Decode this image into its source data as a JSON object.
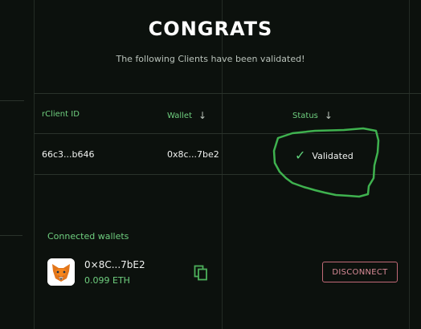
{
  "header": {
    "title": "CONGRATS",
    "subtitle": "The following Clients have been validated!"
  },
  "table": {
    "columns": [
      {
        "label": "rClient ID",
        "sortable": false
      },
      {
        "label": "Wallet",
        "sortable": true,
        "sort_icon": "arrow-down-icon"
      },
      {
        "label": "Status",
        "sortable": true,
        "sort_icon": "arrow-down-icon"
      }
    ],
    "rows": [
      {
        "client_id": "66c3...b646",
        "wallet": "0x8c...7be2",
        "status": "Validated",
        "status_icon": "check-icon"
      }
    ]
  },
  "connected_wallets": {
    "label": "Connected wallets",
    "wallets": [
      {
        "address": "0×8C...7bE2",
        "balance": "0.099 ETH",
        "provider_icon": "metamask-fox-icon"
      }
    ],
    "copy_icon": "copy-icon",
    "disconnect_label": "DISCONNECT"
  },
  "colors": {
    "background": "#0c110d",
    "accent_green": "#6fcf7f",
    "annotation_green": "#3fb24f",
    "disconnect_red": "#c26a78"
  }
}
